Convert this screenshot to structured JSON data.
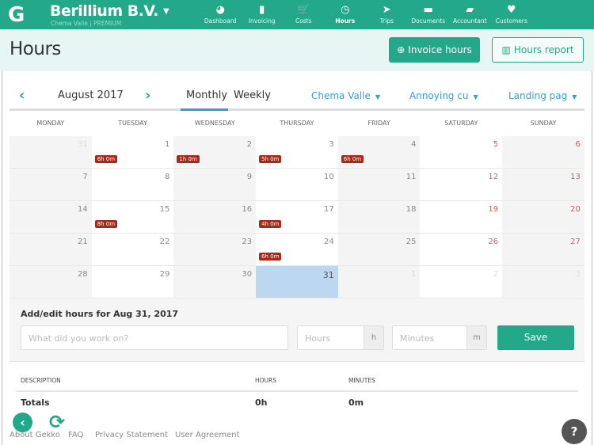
{
  "app": {
    "company": "Berillium B.V.",
    "subtitle": "Chema Valle | PREMIUM"
  },
  "nav": [
    {
      "label": "Dashboard",
      "icon": "dashboard-icon",
      "glyph": "◕"
    },
    {
      "label": "Invoicing",
      "icon": "document-icon",
      "glyph": "▮"
    },
    {
      "label": "Costs",
      "icon": "cart-icon",
      "glyph": "🛒"
    },
    {
      "label": "Hours",
      "icon": "clock-icon",
      "glyph": "◷",
      "active": true
    },
    {
      "label": "Trips",
      "icon": "location-arrow-icon",
      "glyph": "➤"
    },
    {
      "label": "Documents",
      "icon": "briefcase-icon",
      "glyph": "▬"
    },
    {
      "label": "Accountant",
      "icon": "book-icon",
      "glyph": "▰"
    },
    {
      "label": "Customers",
      "icon": "heart-icon",
      "glyph": "♥"
    }
  ],
  "page": {
    "title": "Hours",
    "invoice_btn": "Invoice hours",
    "report_btn": "Hours report"
  },
  "calendar": {
    "month": "August 2017",
    "tab_monthly": "Monthly",
    "tab_weekly": "Weekly",
    "filters": [
      "Chema Valle",
      "Annoying cu",
      "Landing pag"
    ],
    "weekdays": [
      "MONDAY",
      "TUESDAY",
      "WEDNESDAY",
      "THURSDAY",
      "FRIDAY",
      "SATURDAY",
      "SUNDAY"
    ],
    "weeks": [
      [
        {
          "d": "31",
          "m": true
        },
        {
          "d": "1",
          "h": "6h 0m"
        },
        {
          "d": "2",
          "h": "1h 0m"
        },
        {
          "d": "3",
          "h": "5h 0m"
        },
        {
          "d": "4",
          "h": "6h 0m"
        },
        {
          "d": "5",
          "we": true
        },
        {
          "d": "6",
          "we": true
        }
      ],
      [
        {
          "d": "7"
        },
        {
          "d": "8"
        },
        {
          "d": "9"
        },
        {
          "d": "10"
        },
        {
          "d": "11"
        },
        {
          "d": "12",
          "we": true
        },
        {
          "d": "13",
          "we": true
        }
      ],
      [
        {
          "d": "14"
        },
        {
          "d": "15",
          "h": "8h 0m"
        },
        {
          "d": "16"
        },
        {
          "d": "17",
          "h": "4h 0m"
        },
        {
          "d": "18"
        },
        {
          "d": "19",
          "we": true
        },
        {
          "d": "20",
          "we": true
        }
      ],
      [
        {
          "d": "21"
        },
        {
          "d": "22"
        },
        {
          "d": "23"
        },
        {
          "d": "24",
          "h": "6h 0m"
        },
        {
          "d": "25"
        },
        {
          "d": "26",
          "we": true
        },
        {
          "d": "27",
          "we": true
        }
      ],
      [
        {
          "d": "28"
        },
        {
          "d": "29"
        },
        {
          "d": "30"
        },
        {
          "d": "31",
          "sel": true
        },
        {
          "d": "1",
          "m": true
        },
        {
          "d": "2",
          "m": true
        },
        {
          "d": "3",
          "m": true
        }
      ]
    ]
  },
  "form": {
    "title": "Add/edit hours for Aug 31, 2017",
    "desc_placeholder": "What did you work on?",
    "hours_placeholder": "Hours",
    "hours_suffix": "h",
    "minutes_placeholder": "Minutes",
    "minutes_suffix": "m",
    "save": "Save"
  },
  "table": {
    "headers": [
      "DESCRIPTION",
      "HOURS",
      "MINUTES"
    ],
    "totals_label": "Totals",
    "total_hours": "0h",
    "total_minutes": "0m"
  },
  "footer": {
    "links": [
      "About Gekko",
      "FAQ",
      "Privacy Statement",
      "User Agreement"
    ],
    "help": "?"
  }
}
